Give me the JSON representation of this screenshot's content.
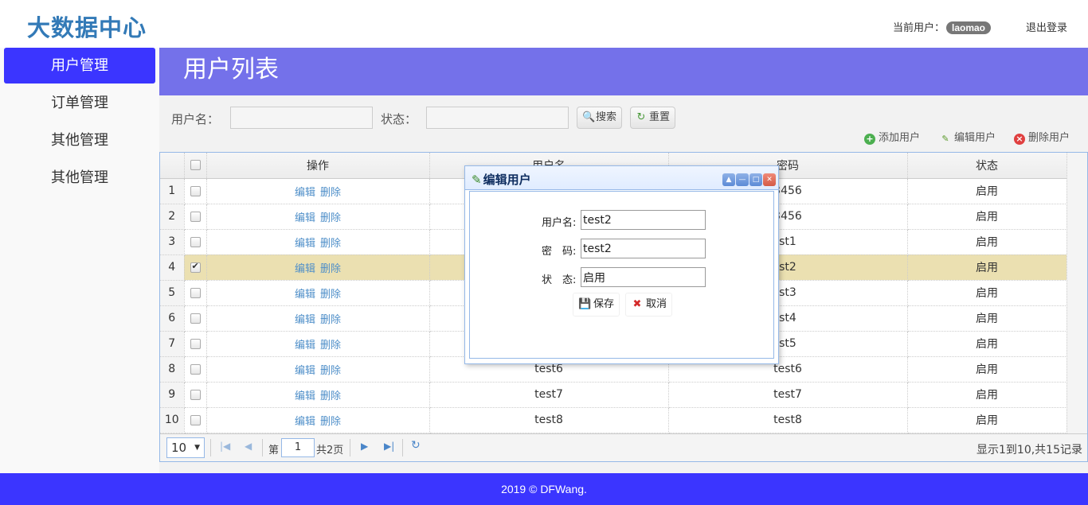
{
  "header": {
    "logo": "大数据中心",
    "current_user_label": "当前用户：",
    "current_user": "laomao",
    "logout": "退出登录"
  },
  "sidebar": {
    "items": [
      {
        "label": "用户管理",
        "active": true
      },
      {
        "label": "订单管理",
        "active": false
      },
      {
        "label": "其他管理",
        "active": false
      },
      {
        "label": "其他管理",
        "active": false
      }
    ]
  },
  "main": {
    "title": "用户列表",
    "search": {
      "username_label": "用户名：",
      "status_label": "状态：",
      "search_btn": "搜索",
      "reset_btn": "重置"
    },
    "actions": {
      "add": "添加用户",
      "edit": "编辑用户",
      "delete": "删除用户"
    }
  },
  "grid": {
    "columns": [
      "操作",
      "用户名",
      "密码",
      "状态"
    ],
    "op_edit": "编辑",
    "op_delete": "删除",
    "rows": [
      {
        "n": "1",
        "user": "",
        "pwd": "3456",
        "status": "启用",
        "checked": false
      },
      {
        "n": "2",
        "user": "",
        "pwd": "3456",
        "status": "启用",
        "checked": false
      },
      {
        "n": "3",
        "user": "",
        "pwd": "st1",
        "status": "启用",
        "checked": false
      },
      {
        "n": "4",
        "user": "",
        "pwd": "st2",
        "status": "启用",
        "checked": true
      },
      {
        "n": "5",
        "user": "",
        "pwd": "st3",
        "status": "启用",
        "checked": false
      },
      {
        "n": "6",
        "user": "",
        "pwd": "st4",
        "status": "启用",
        "checked": false
      },
      {
        "n": "7",
        "user": "",
        "pwd": "st5",
        "status": "启用",
        "checked": false
      },
      {
        "n": "8",
        "user": "test6",
        "pwd": "test6",
        "status": "启用",
        "checked": false
      },
      {
        "n": "9",
        "user": "test7",
        "pwd": "test7",
        "status": "启用",
        "checked": false
      },
      {
        "n": "10",
        "user": "test8",
        "pwd": "test8",
        "status": "启用",
        "checked": false
      }
    ]
  },
  "pager": {
    "page_size": "10",
    "page_prefix": "第",
    "page_num": "1",
    "page_total": "共2页",
    "info": "显示1到10,共15记录"
  },
  "dialog": {
    "title": "编辑用户",
    "username_label": "用户名:",
    "username_value": "test2",
    "password_label": "密　码:",
    "password_value": "test2",
    "status_label": "状　态:",
    "status_value": "启用",
    "save_btn": "保存",
    "cancel_btn": "取消"
  },
  "footer": {
    "text": "2019 © DFWang."
  }
}
